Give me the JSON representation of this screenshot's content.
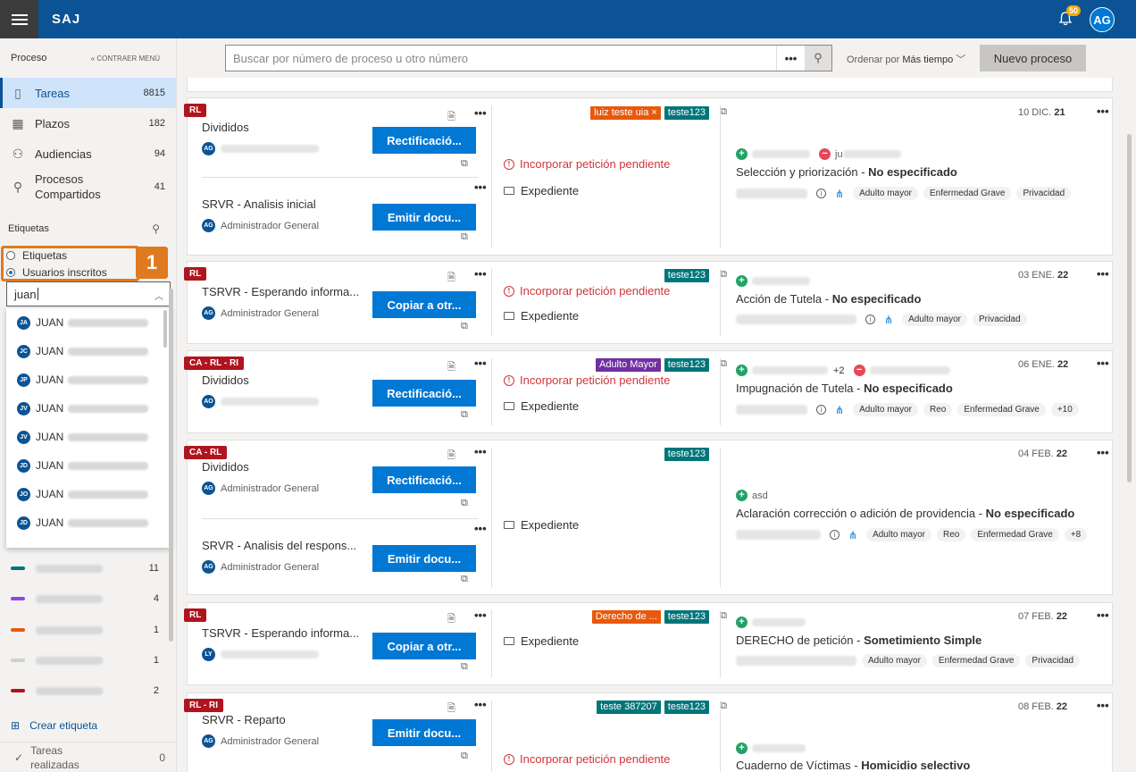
{
  "app": {
    "brand": "SAJ",
    "notif_count": "50",
    "user_initials": "AG"
  },
  "sidebar": {
    "header": "Proceso",
    "collapse_label": "« CONTRAER MENÚ",
    "nav": [
      {
        "label": "Tareas",
        "count": "8815",
        "icon": "tasks-icon"
      },
      {
        "label": "Plazos",
        "count": "182",
        "icon": "calendar-icon"
      },
      {
        "label": "Audiencias",
        "count": "94",
        "icon": "people-icon"
      },
      {
        "label": "Procesos Compartidos",
        "count": "41",
        "icon": "shared-icon"
      }
    ],
    "tags_title": "Etiquetas",
    "radio": {
      "option1": "Etiquetas",
      "option2": "Usuarios inscritos"
    },
    "step_number": "1",
    "filter_value": "juan",
    "dropdown": [
      {
        "initials": "JA",
        "name": "JUAN"
      },
      {
        "initials": "JC",
        "name": "JUAN"
      },
      {
        "initials": "JP",
        "name": "JUAN"
      },
      {
        "initials": "JV",
        "name": "JUAN"
      },
      {
        "initials": "JV",
        "name": "JUAN"
      },
      {
        "initials": "JD",
        "name": "JUAN"
      },
      {
        "initials": "JO",
        "name": "JUAN"
      },
      {
        "initials": "JD",
        "name": "JUAN"
      }
    ],
    "tags": [
      {
        "color": "#00757a",
        "count": "11"
      },
      {
        "color": "#8e44ec",
        "count": "4"
      },
      {
        "color": "#e8590c",
        "count": "1"
      },
      {
        "color": "#d0d0d0",
        "count": "1"
      },
      {
        "color": "#b0141f",
        "count": "2"
      }
    ],
    "create_tag": "Crear etiqueta",
    "done": {
      "label": "Tareas realizadas",
      "count": "0"
    }
  },
  "toolbar": {
    "search_placeholder": "Buscar por número de proceso u otro número",
    "more": "•••",
    "order_prefix": "Ordenar por",
    "order_value": "Más tiempo",
    "new_process": "Nuevo proceso"
  },
  "cards": [
    {
      "ribbon": "RL",
      "tasks": [
        {
          "name": "Divididos",
          "initials": "AG",
          "user": "",
          "action": "Rectificació..."
        },
        {
          "name": "SRVR - Analisis inicial",
          "initials": "AG",
          "user": "Administrador General",
          "action": "Emitir docu..."
        }
      ],
      "chips": [
        {
          "text": "luiz teste uia  ×",
          "color": "#e8590c"
        },
        {
          "text": "teste123",
          "color": "#00757a"
        }
      ],
      "pending": "Incorporar petición pendiente",
      "expediente": "Expediente",
      "date_pre": "10 DIC.",
      "date_day": "21",
      "process": "Selección y priorización",
      "process_type": "No especificado",
      "pills": [
        "Adulto mayor",
        "Enfermedad Grave",
        "Privacidad"
      ],
      "party_text": "ju"
    },
    {
      "ribbon": "RL",
      "tasks": [
        {
          "name": "TSRVR - Esperando informa...",
          "initials": "AG",
          "user": "Administrador General",
          "action": "Copiar a otr..."
        }
      ],
      "chips": [
        {
          "text": "teste123",
          "color": "#00757a"
        }
      ],
      "pending": "Incorporar petición pendiente",
      "expediente": "Expediente",
      "date_pre": "03 ENE.",
      "date_day": "22",
      "process": "Acción de Tutela",
      "process_type": "No especificado",
      "pills": [
        "Adulto mayor",
        "Privacidad"
      ]
    },
    {
      "ribbon": "CA - RL - RI",
      "tasks": [
        {
          "name": "Divididos",
          "initials": "AO",
          "user": "",
          "action": "Rectificació..."
        }
      ],
      "chips": [
        {
          "text": "Adulto Mayor",
          "color": "#7030a0"
        },
        {
          "text": "teste123",
          "color": "#00757a"
        }
      ],
      "pending": "Incorporar petición pendiente",
      "expediente": "Expediente",
      "date_pre": "06 ENE.",
      "date_day": "22",
      "process": "Impugnación de Tutela",
      "process_type": "No especificado",
      "pills": [
        "Adulto mayor",
        "Reo",
        "Enfermedad Grave",
        "+10"
      ],
      "plus_more": "+2"
    },
    {
      "ribbon": "CA - RL",
      "tasks": [
        {
          "name": "Divididos",
          "initials": "AG",
          "user": "Administrador General",
          "action": "Rectificació..."
        },
        {
          "name": "SRVR - Analisis del respons...",
          "initials": "AG",
          "user": "Administrador General",
          "action": "Emitir docu..."
        }
      ],
      "chips": [
        {
          "text": "teste123",
          "color": "#00757a"
        }
      ],
      "expediente": "Expediente",
      "date_pre": "04 FEB.",
      "date_day": "22",
      "party_name": "asd",
      "process": "Aclaración corrección o adición de providencia",
      "process_type": "No especificado",
      "pills": [
        "Adulto mayor",
        "Reo",
        "Enfermedad Grave",
        "+8"
      ]
    },
    {
      "ribbon": "RL",
      "tasks": [
        {
          "name": "TSRVR - Esperando informa...",
          "initials": "LY",
          "user": "",
          "action": "Copiar a otr..."
        }
      ],
      "chips": [
        {
          "text": "Derecho de ...",
          "color": "#e8590c"
        },
        {
          "text": "teste123",
          "color": "#00757a"
        }
      ],
      "expediente": "Expediente",
      "date_pre": "07 FEB.",
      "date_day": "22",
      "process": "DERECHO de petición",
      "process_type": "Sometimiento Simple",
      "pills": [
        "Adulto mayor",
        "Enfermedad Grave",
        "Privacidad"
      ]
    },
    {
      "ribbon": "RL - RI",
      "tasks": [
        {
          "name": "SRVR - Reparto",
          "initials": "AG",
          "user": "Administrador General",
          "action": "Emitir docu..."
        }
      ],
      "chips": [
        {
          "text": "teste 387207",
          "color": "#00757a"
        },
        {
          "text": "teste123",
          "color": "#00757a"
        }
      ],
      "pending": "Incorporar petición pendiente",
      "date_pre": "08 FEB.",
      "date_day": "22",
      "process": "Cuaderno de Víctimas",
      "process_type": "Homicidio selectivo"
    }
  ]
}
